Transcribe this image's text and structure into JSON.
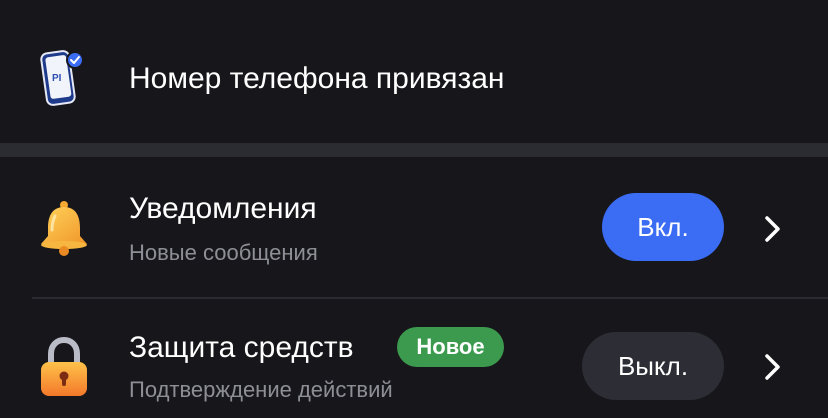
{
  "phone_row": {
    "title": "Номер телефона привязан",
    "icon": "phone-check-icon",
    "icon_label": "PI"
  },
  "notifications_row": {
    "title": "Уведомления",
    "subtitle": "Новые сообщения",
    "toggle_label": "Вкл.",
    "toggle_state": "on",
    "icon": "bell-icon"
  },
  "protection_row": {
    "title": "Защита средств",
    "badge": "Новое",
    "subtitle": "Подтверждение действий",
    "toggle_label": "Выкл.",
    "toggle_state": "off",
    "icon": "lock-icon"
  },
  "colors": {
    "background": "#16161b",
    "accent_blue": "#3b6cf4",
    "badge_green": "#3c9a4e",
    "pill_off": "#2d2d35",
    "subtitle_gray": "#8e8e96"
  }
}
